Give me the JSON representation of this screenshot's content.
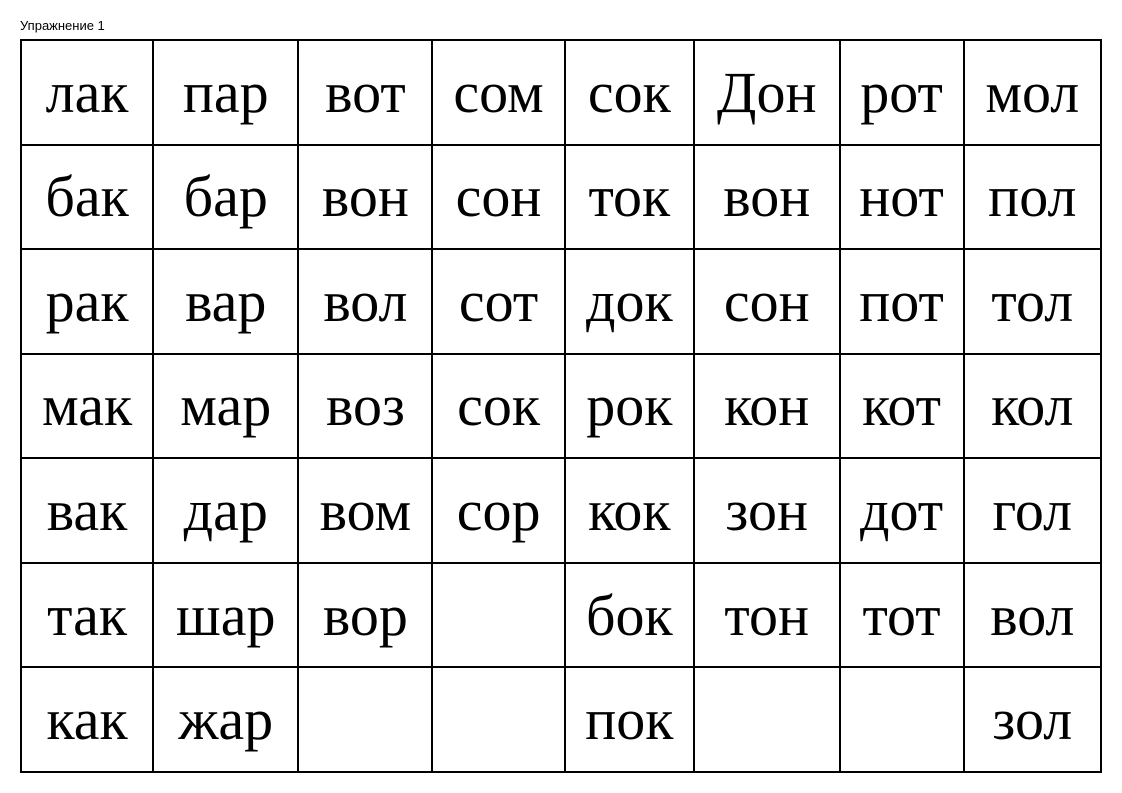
{
  "title": "Упражнение 1",
  "rows": [
    [
      "лак",
      "пар",
      "вот",
      "сом",
      "сок",
      "Дон",
      "рот",
      "мол"
    ],
    [
      "бак",
      "бар",
      "вон",
      "сон",
      "ток",
      "вон",
      "нот",
      "пол"
    ],
    [
      "рак",
      "вар",
      "вол",
      "сот",
      "док",
      "сон",
      "пот",
      "тол"
    ],
    [
      "мак",
      "мар",
      "воз",
      "сок",
      "рок",
      "кон",
      "кот",
      "кол"
    ],
    [
      "вак",
      "дар",
      "вом",
      "сор",
      "кок",
      "зон",
      "дот",
      "гол"
    ],
    [
      "так",
      "шар",
      "вор",
      "",
      "бок",
      "тон",
      "тот",
      "вол"
    ],
    [
      "как",
      "жар",
      "",
      "",
      "пок",
      "",
      "",
      "зол"
    ]
  ]
}
